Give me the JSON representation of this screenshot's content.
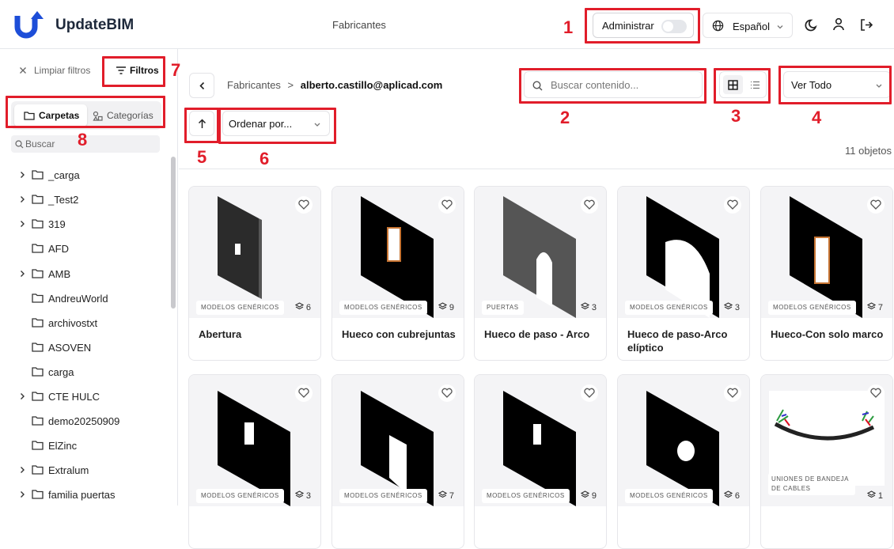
{
  "header": {
    "brand": "UpdateBIM",
    "title": "Fabricantes",
    "admin_label": "Administrar",
    "admin_toggle_on": false,
    "language": "Español",
    "icons": [
      "moon-icon",
      "user-icon",
      "logout-icon",
      "globe-icon",
      "chevron-down-icon"
    ]
  },
  "sidebar": {
    "clear_filters": "Limpiar filtros",
    "filters": "Filtros",
    "tabs": [
      {
        "label": "Carpetas",
        "active": true
      },
      {
        "label": "Categorías",
        "active": false
      }
    ],
    "search_placeholder": "Buscar",
    "tree": [
      {
        "name": "_carga",
        "expandable": true
      },
      {
        "name": "_Test2",
        "expandable": true
      },
      {
        "name": "319",
        "expandable": true
      },
      {
        "name": "AFD",
        "expandable": false
      },
      {
        "name": "AMB",
        "expandable": true
      },
      {
        "name": "AndreuWorld",
        "expandable": false
      },
      {
        "name": "archivostxt",
        "expandable": false
      },
      {
        "name": "ASOVEN",
        "expandable": false
      },
      {
        "name": "carga",
        "expandable": false
      },
      {
        "name": "CTE HULC",
        "expandable": true
      },
      {
        "name": "demo20250909",
        "expandable": false
      },
      {
        "name": "ElZinc",
        "expandable": false
      },
      {
        "name": "Extralum",
        "expandable": true
      },
      {
        "name": "familia puertas",
        "expandable": true
      }
    ]
  },
  "main": {
    "breadcrumb_root": "Fabricantes",
    "breadcrumb_sep": ">",
    "breadcrumb_current": "alberto.castillo@aplicad.com",
    "search_placeholder": "Buscar contenido...",
    "view_select": "Ver Todo",
    "sort_placeholder": "Ordenar por...",
    "count": "11 objetos",
    "cards": [
      {
        "title": "Abertura",
        "category": "MODELOS GENÉRICOS",
        "count": "6"
      },
      {
        "title": "Hueco con cubrejuntas",
        "category": "MODELOS GENÉRICOS",
        "count": "9"
      },
      {
        "title": "Hueco de paso - Arco",
        "category": "PUERTAS",
        "count": "3"
      },
      {
        "title": "Hueco de paso-Arco elíptico",
        "category": "MODELOS GENÉRICOS",
        "count": "3"
      },
      {
        "title": "Hueco-Con solo marco",
        "category": "MODELOS GENÉRICOS",
        "count": "7"
      },
      {
        "title": "",
        "category": "MODELOS GENÉRICOS",
        "count": "3"
      },
      {
        "title": "",
        "category": "MODELOS GENÉRICOS",
        "count": "7"
      },
      {
        "title": "",
        "category": "MODELOS GENÉRICOS",
        "count": "9"
      },
      {
        "title": "",
        "category": "MODELOS GENÉRICOS",
        "count": "6"
      },
      {
        "title": "",
        "category": "UNIONES DE BANDEJA DE CABLES",
        "count": "1"
      }
    ]
  },
  "annotations": [
    "1",
    "2",
    "3",
    "4",
    "5",
    "6",
    "7",
    "8"
  ],
  "colors": {
    "accent": "#1d4ed8",
    "annotation": "#e11d2a"
  }
}
